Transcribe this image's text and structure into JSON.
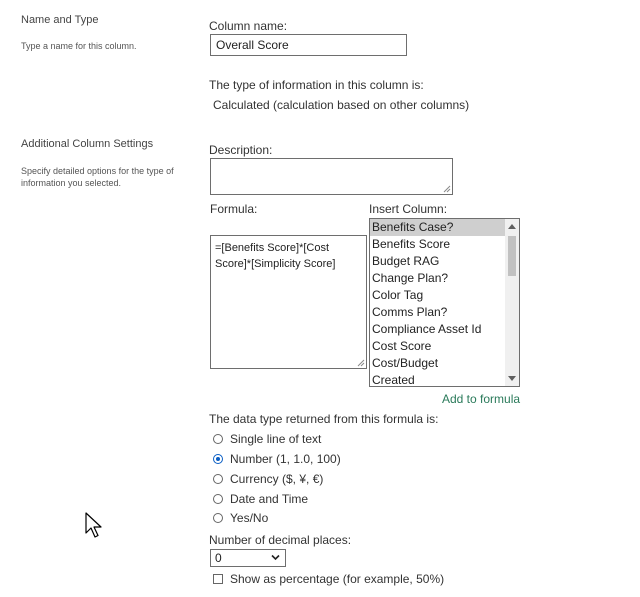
{
  "name_section": {
    "title": "Name and Type",
    "description": "Type a name for this column."
  },
  "column_name": {
    "label": "Column name:",
    "value": "Overall Score"
  },
  "type_info": {
    "label": "The type of information in this column is:",
    "value": "Calculated (calculation based on other columns)"
  },
  "additional_section": {
    "title": "Additional Column Settings",
    "description_line1": "Specify detailed options for the type of",
    "description_line2": "information you selected."
  },
  "description_field": {
    "label": "Description:",
    "value": ""
  },
  "formula": {
    "label": "Formula:",
    "line1": "=[Benefits Score]*[Cost",
    "line2": "Score]*[Simplicity Score]"
  },
  "insert_column": {
    "label": "Insert Column:",
    "items": [
      "Benefits Case?",
      "Benefits Score",
      "Budget RAG",
      "Change Plan?",
      "Color Tag",
      "Comms Plan?",
      "Compliance Asset Id",
      "Cost Score",
      "Cost/Budget",
      "Created"
    ],
    "selected_index": 0,
    "add_link": "Add to formula"
  },
  "return_type": {
    "label": "The data type returned from this formula is:",
    "options": [
      {
        "label": "Single line of text",
        "checked": false
      },
      {
        "label": "Number (1, 1.0, 100)",
        "checked": true
      },
      {
        "label": "Currency ($, ¥, €)",
        "checked": false
      },
      {
        "label": "Date and Time",
        "checked": false
      },
      {
        "label": "Yes/No",
        "checked": false
      }
    ]
  },
  "decimal_places": {
    "label": "Number of decimal places:",
    "value": "0"
  },
  "percentage": {
    "label": "Show as percentage (for example, 50%)",
    "checked": false
  },
  "colors": {
    "accent": "#0a5ec4",
    "link": "#2a7a5a",
    "selected_item": "#cfcfcf"
  }
}
